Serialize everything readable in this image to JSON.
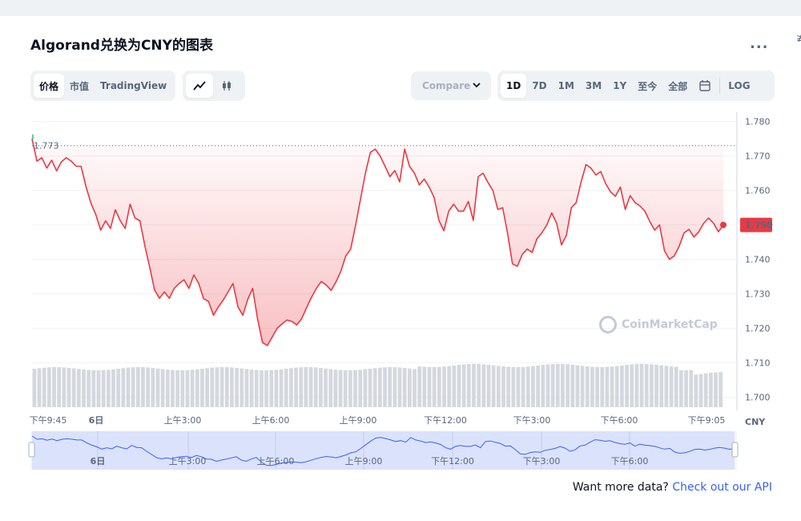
{
  "header": {
    "title": "Algorand兑换为CNY的图表",
    "more_label": "...",
    "edge_glyph": "≱"
  },
  "view_tabs": [
    "价格",
    "市值",
    "TradingView"
  ],
  "chart_modes": [
    {
      "icon": "line-chart-icon",
      "active": true
    },
    {
      "icon": "candlestick-icon",
      "active": false
    }
  ],
  "compare": {
    "label": "Compare"
  },
  "range_tabs": [
    "1D",
    "7D",
    "1M",
    "3M",
    "1Y",
    "至今",
    "全部"
  ],
  "range_active": "1D",
  "calendar_icon": "calendar-icon",
  "log_label": "LOG",
  "colors": {
    "line": "#ea3943",
    "fill": "#ea3943",
    "volume": "#d4d8de",
    "brush": "#d8e0fb",
    "brush_line": "#3861fb"
  },
  "watermark": "CoinMarketCap",
  "footer": {
    "text": "Want more data?",
    "link": "Check out our API"
  },
  "chart_data": {
    "type": "area",
    "x": [
      "下午9:45",
      "6日",
      "上午3:00",
      "上午6:00",
      "上午9:00",
      "下午12:00",
      "下午3:00",
      "下午6:00",
      "下午9:05"
    ],
    "brush_x": [
      "6日",
      "上午3:00",
      "上午6:00",
      "上午9:00",
      "下午12:00",
      "下午3:00",
      "下午6:00"
    ],
    "y_ticks": [
      "1.780",
      "1.770",
      "1.760",
      "1.750",
      "1.740",
      "1.730",
      "1.720",
      "1.710",
      "1.700"
    ],
    "ylim": [
      1.6962,
      1.7827
    ],
    "open_price": "1.773",
    "current_price": "1.750",
    "currency": "CNY",
    "series": [
      {
        "values": [
          1.775,
          1.7685,
          1.7695,
          1.7665,
          1.7688,
          1.7657,
          1.7683,
          1.7695,
          1.7685,
          1.767,
          1.767,
          1.7612,
          1.7564,
          1.753,
          1.7485,
          1.7512,
          1.749,
          1.7544,
          1.7512,
          1.749,
          1.756,
          1.752,
          1.7512,
          1.744,
          1.7377,
          1.7311,
          1.7287,
          1.7306,
          1.7287,
          1.7316,
          1.733,
          1.7341,
          1.7316,
          1.7355,
          1.733,
          1.7286,
          1.7278,
          1.7238,
          1.7262,
          1.7282,
          1.7306,
          1.733,
          1.7262,
          1.7238,
          1.7284,
          1.7316,
          1.7228,
          1.7159,
          1.715,
          1.7175,
          1.72,
          1.7213,
          1.7224,
          1.722,
          1.721,
          1.7228,
          1.726,
          1.729,
          1.7316,
          1.7336,
          1.7326,
          1.731,
          1.7335,
          1.7366,
          1.741,
          1.743,
          1.75,
          1.7575,
          1.765,
          1.771,
          1.772,
          1.77,
          1.767,
          1.764,
          1.7658,
          1.7625,
          1.772,
          1.767,
          1.765,
          1.7616,
          1.7633,
          1.761,
          1.758,
          1.7513,
          1.7483,
          1.754,
          1.756,
          1.754,
          1.754,
          1.7568,
          1.7513,
          1.764,
          1.765,
          1.7623,
          1.76,
          1.7545,
          1.755,
          1.7475,
          1.7387,
          1.738,
          1.7415,
          1.743,
          1.742,
          1.746,
          1.7477,
          1.75,
          1.7535,
          1.7505,
          1.7442,
          1.747,
          1.755,
          1.7565,
          1.7625,
          1.7675,
          1.7665,
          1.7645,
          1.7655,
          1.762,
          1.7596,
          1.7583,
          1.761,
          1.7545,
          1.7585,
          1.7565,
          1.7555,
          1.754,
          1.751,
          1.7485,
          1.75,
          1.7425,
          1.74,
          1.741,
          1.7438,
          1.7477,
          1.7487,
          1.7465,
          1.748,
          1.7505,
          1.752,
          1.7505,
          1.748,
          1.75
        ]
      }
    ]
  }
}
